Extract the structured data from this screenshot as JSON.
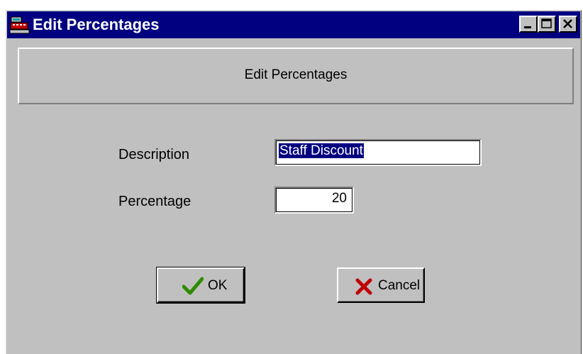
{
  "window": {
    "title": "Edit Percentages",
    "buttons": {
      "minimize": "minimize-icon",
      "maximize": "maximize-icon",
      "close": "close-icon"
    }
  },
  "header": {
    "text": "Edit Percentages"
  },
  "form": {
    "description_label": "Description",
    "description_value": "Staff Discount",
    "percentage_label": "Percentage",
    "percentage_value": "20"
  },
  "actions": {
    "ok_label": "OK",
    "ok_icon": "checkmark-icon",
    "cancel_label": "Cancel",
    "cancel_icon": "x-icon"
  },
  "colors": {
    "titlebar": "#000080",
    "face": "#c0c0c0",
    "selection": "#000080",
    "ok_icon": "#2e8b00",
    "cancel_icon": "#c00000"
  }
}
